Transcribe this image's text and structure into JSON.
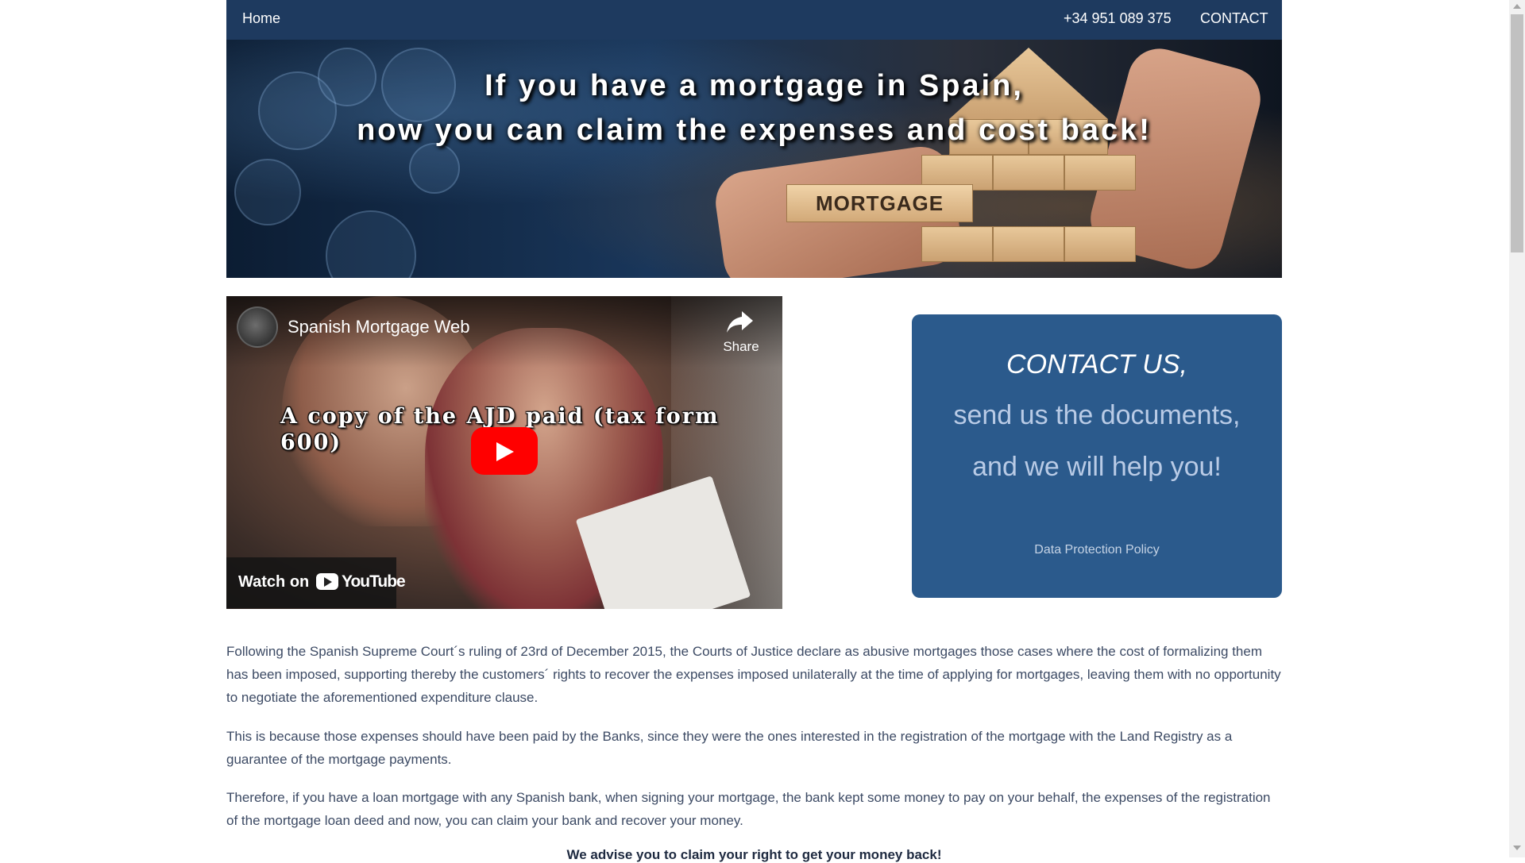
{
  "nav": {
    "home": "Home",
    "phone": "+34 951 089 375",
    "contact": "CONTACT"
  },
  "hero": {
    "line1": "If you have a mortgage in Spain,",
    "line2": "now you can claim the expenses and cost back!",
    "block_label": "MORTGAGE"
  },
  "video": {
    "channel_title": "Spanish Mortgage Web",
    "share_label": "Share",
    "caption": "A copy of the AJD paid (tax form 600)",
    "watch_on": "Watch on",
    "youtube": "YouTube",
    "icons": [
      "channel-avatar",
      "share-icon",
      "play-icon",
      "youtube-logo-icon"
    ]
  },
  "contact_box": {
    "line1": "CONTACT US,",
    "line2": "send us the documents,",
    "line3": "and we will help you!",
    "policy_link": "Data Protection Policy"
  },
  "content": {
    "p1": "Following the Spanish Supreme Court´s ruling of 23rd of December 2015, the Courts of Justice declare as abusive mortgages those cases where the cost of formalizing them has been imposed, supporting thereby the customers´ rights to recover the expenses imposed unilaterally at the time of applying for mortgages, leaving them with no opportunity to negotiate the aforementioned expenditure clause.",
    "p2": "This is because those expenses should have been paid by the Banks, since they were the ones interested in the registration of the mortgage with the Land Registry as a guarantee of the mortgage payments.",
    "p3": "Therefore, if you have a loan mortgage with any Spanish bank, when signing your mortgage, the bank kept some money to pay on your behalf, the expenses of the registration of the mortgage loan deed and now, you can claim your bank and recover your money.",
    "advise": "We advise you to claim your right to get your money back!"
  },
  "colors": {
    "nav_bg": "#1e3a5f",
    "contact_box_bg": "#2b5a8c",
    "body_text": "#3c4a64",
    "youtube_red": "#ff0000"
  }
}
